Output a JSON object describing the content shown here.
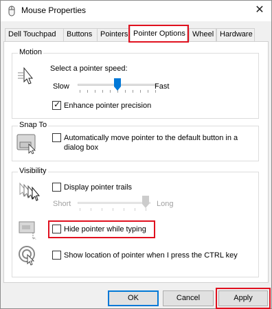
{
  "window": {
    "title": "Mouse Properties",
    "close_glyph": "✕"
  },
  "tabs": [
    {
      "label": "Dell Touchpad"
    },
    {
      "label": "Buttons"
    },
    {
      "label": "Pointers"
    },
    {
      "label": "Pointer Options",
      "active": true
    },
    {
      "label": "Wheel"
    },
    {
      "label": "Hardware"
    }
  ],
  "motion": {
    "title": "Motion",
    "speed_label": "Select a pointer speed:",
    "slow_label": "Slow",
    "fast_label": "Fast",
    "speed_level": 0.5,
    "precision_label": "Enhance pointer precision",
    "precision_checked": true
  },
  "snap_to": {
    "title": "Snap To",
    "label_line1": "Automatically move pointer to the default button in a",
    "label_line2": "dialog box",
    "checked": false
  },
  "visibility": {
    "title": "Visibility",
    "trails_label": "Display pointer trails",
    "trails_checked": false,
    "short_label": "Short",
    "long_label": "Long",
    "trail_level": 1.0,
    "hide_label": "Hide pointer while typing",
    "hide_checked": false,
    "show_location_label": "Show location of pointer when I press the CTRL key",
    "show_location_checked": false
  },
  "buttons": {
    "ok": "OK",
    "cancel": "Cancel",
    "apply": "Apply"
  },
  "colors": {
    "highlight": "#e0101e",
    "slider_thumb": "#0078d7"
  }
}
